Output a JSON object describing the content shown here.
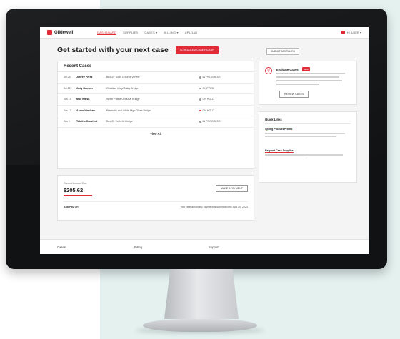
{
  "topbar": {
    "logo_text": "Glidewell",
    "nav": [
      "DASHBOARD",
      "SUPPLIES",
      "CASES ▾",
      "BILLING ▾",
      "UPLOAD"
    ],
    "user": "Hi, USER ▾"
  },
  "heading": {
    "title": "Get started with your next case",
    "primary_button": "SCHEDULE A CASE PICKUP",
    "secondary_button": "SUBMIT DIGITAL RX"
  },
  "recent_cases": {
    "title": "Recent Cases",
    "rows": [
      {
        "date": "Jul 25",
        "name": "Jeffrey Perez",
        "desc": "BruxZir Solid Zirconia Veneer",
        "status": "IN PROGRESS",
        "status_color": "#9a9a9a"
      },
      {
        "date": "Jul 22",
        "name": "Judy Brunner",
        "desc": "Obsidian Inlay/Onlay Bridge",
        "status": "SHIPPED",
        "status_color": "#9a9a9a"
      },
      {
        "date": "Jun 19",
        "name": "Max Walsh",
        "desc": "White Patina Occlusal Bridge",
        "status": "ON HOLD",
        "status_color": "#9a9a9a"
      },
      {
        "date": "Jun 17",
        "name": "Aaron Hinshaw",
        "desc": "Prismatic and White High Gloss Bridge",
        "status": "ON HOLD",
        "status_color": "#e12b36"
      },
      {
        "date": "Jun 5",
        "name": "Tabitha Crawford",
        "desc": "BruxZir Esthetic Bridge",
        "status": "IN PROGRESS",
        "status_color": "#9a9a9a"
      }
    ],
    "view_all": "View All"
  },
  "payment": {
    "label": "Current Amount Due",
    "amount": "$205.62",
    "button": "MAKE A PAYMENT",
    "autopay_label": "AutoPay On",
    "autopay_note": "Your next automatic payment is scheduled for Aug 20, 2023"
  },
  "evaluate": {
    "title": "Evaluate Cases",
    "badge": "NEW",
    "button": "REVIEW CASES"
  },
  "quick_links": {
    "title": "Quick Links",
    "items": [
      "Spring Product Promo",
      "Request Case Supplies"
    ]
  },
  "footer": {
    "links": [
      "Cases",
      "Billing",
      "Support"
    ]
  },
  "colors": {
    "brand_red": "#e12b36",
    "teal_background": "#e4f1ef"
  }
}
